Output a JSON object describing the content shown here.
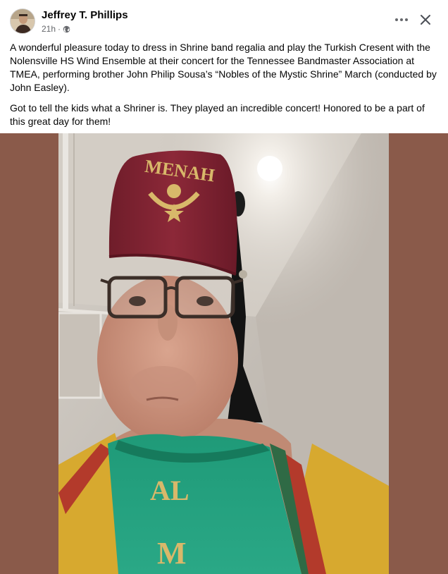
{
  "post": {
    "author": "Jeffrey T. Phillips",
    "time": "21h",
    "separator": "·",
    "caption_p1": "A wonderful pleasure today to dress in Shrine band regalia and play the Turkish Cresent with the Nolensville HS Wind Ensemble at their concert for the Tennessee Bandmaster Association at TMEA, performing brother John Philip Sousa’s “Nobles of the Mystic Shrine” March (conducted by John Easley).",
    "caption_p2": "Got to tell the kids what a Shriner is. They played an incredible concert! Honored to be a part of this great day for them!"
  },
  "photo": {
    "fez_text": "MENAH",
    "vest_text_1": "AL",
    "vest_text_2": "M"
  },
  "icons": {
    "privacy": "globe-icon",
    "more": "more-options-icon",
    "close": "close-icon"
  },
  "colors": {
    "media_background": "#8a5a4a",
    "secondary_text": "#65676b"
  }
}
